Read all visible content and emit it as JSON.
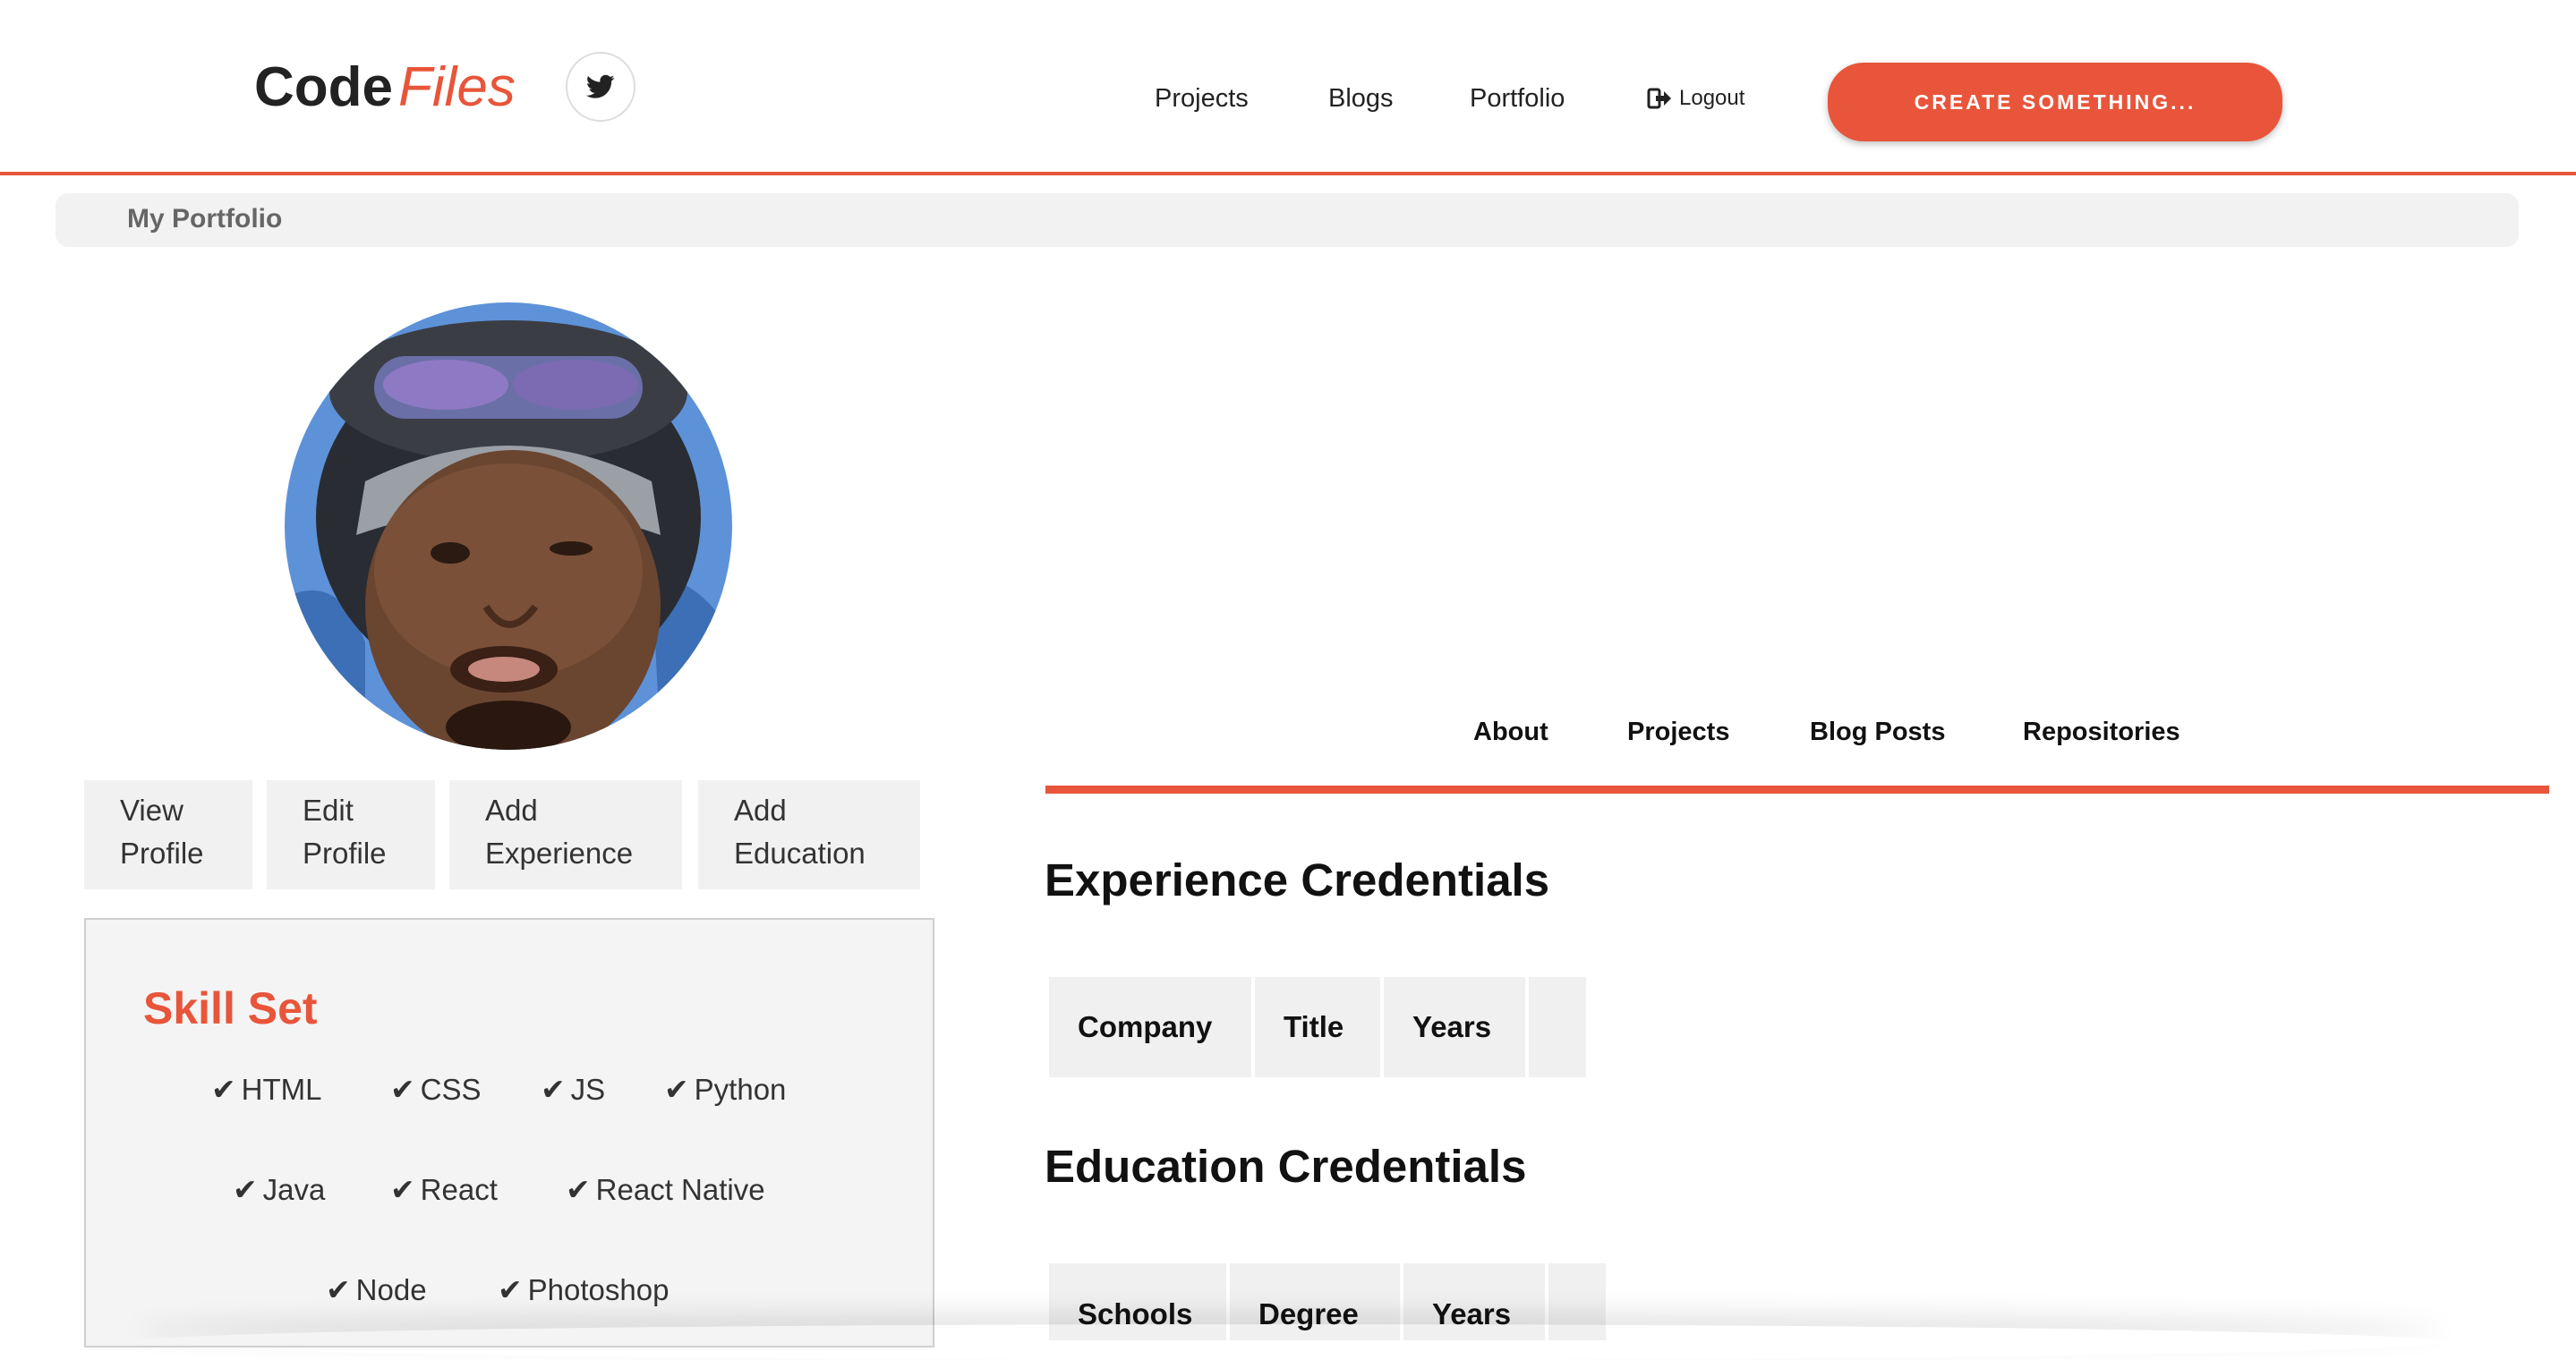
{
  "header": {
    "logo_code": "Code",
    "logo_files": "Files",
    "twitter_icon": "twitter-icon",
    "nav": [
      "Projects",
      "Blogs",
      "Portfolio"
    ],
    "logout_label": "Logout",
    "logout_icon": "sign-out-icon",
    "cta_label": "CREATE SOMETHING..."
  },
  "breadcrumb": {
    "title": "My Portfolio"
  },
  "profile": {
    "avatar_alt": "profile photo",
    "actions": [
      {
        "line1": "View",
        "line2": "Profile"
      },
      {
        "line1": "Edit",
        "line2": "Profile"
      },
      {
        "line1": "Add",
        "line2": "Experience"
      },
      {
        "line1": "Add",
        "line2": "Education"
      }
    ]
  },
  "skills": {
    "title": "Skill Set",
    "check_icon": "check-icon",
    "items": [
      "HTML",
      "CSS",
      "JS",
      "Python",
      "Java",
      "React",
      "React Native",
      "Node",
      "Photoshop"
    ]
  },
  "tabs": [
    "About",
    "Projects",
    "Blog Posts",
    "Repositories"
  ],
  "experience": {
    "title": "Experience Credentials",
    "columns": [
      "Company",
      "Title",
      "Years",
      ""
    ]
  },
  "education": {
    "title": "Education Credentials",
    "columns": [
      "Schools",
      "Degree",
      "Years",
      ""
    ]
  },
  "colors": {
    "accent": "#e8553a",
    "panel": "#f2f2f2"
  }
}
